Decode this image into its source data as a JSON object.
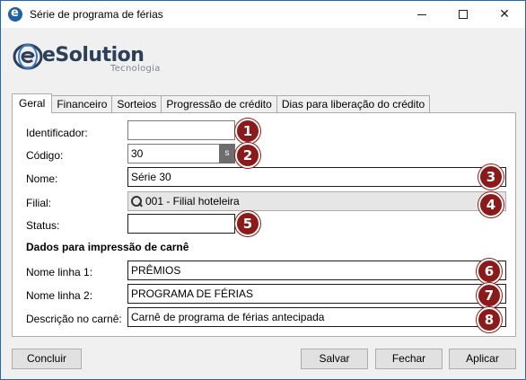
{
  "window": {
    "title": "Série de programa de férias"
  },
  "logo": {
    "brand": "eSolution",
    "tagline": "Tecnologia"
  },
  "tabs": [
    {
      "label": "Geral",
      "active": true
    },
    {
      "label": "Financeiro",
      "active": false
    },
    {
      "label": "Sorteios",
      "active": false
    },
    {
      "label": "Progressão de crédito",
      "active": false
    },
    {
      "label": "Dias para liberação do crédito",
      "active": false
    }
  ],
  "form": {
    "identificador": {
      "label": "Identificador:",
      "value": ""
    },
    "codigo": {
      "label": "Código:",
      "value": "30",
      "button": "s"
    },
    "nome": {
      "label": "Nome:",
      "value": "Série 30"
    },
    "filial": {
      "label": "Filial:",
      "value": "001 - Filial hoteleira"
    },
    "status": {
      "label": "Status:",
      "value": ""
    },
    "section_title": "Dados para impressão de carnê",
    "nome_linha_1": {
      "label": "Nome linha 1:",
      "value": "PRÊMIOS"
    },
    "nome_linha_2": {
      "label": "Nome linha 2:",
      "value": "PROGRAMA DE FÉRIAS"
    },
    "descricao": {
      "label": "Descrição no carnê:",
      "value": "Carnê de programa de férias antecipada"
    }
  },
  "badges": [
    "1",
    "2",
    "3",
    "4",
    "5",
    "6",
    "7",
    "8"
  ],
  "buttons": {
    "concluir": "Concluir",
    "salvar": "Salvar",
    "fechar": "Fechar",
    "aplicar": "Aplicar"
  },
  "colors": {
    "badge": "#8b1a1a",
    "window_border": "#1e6ab8",
    "brand_dark": "#2c3e58"
  }
}
